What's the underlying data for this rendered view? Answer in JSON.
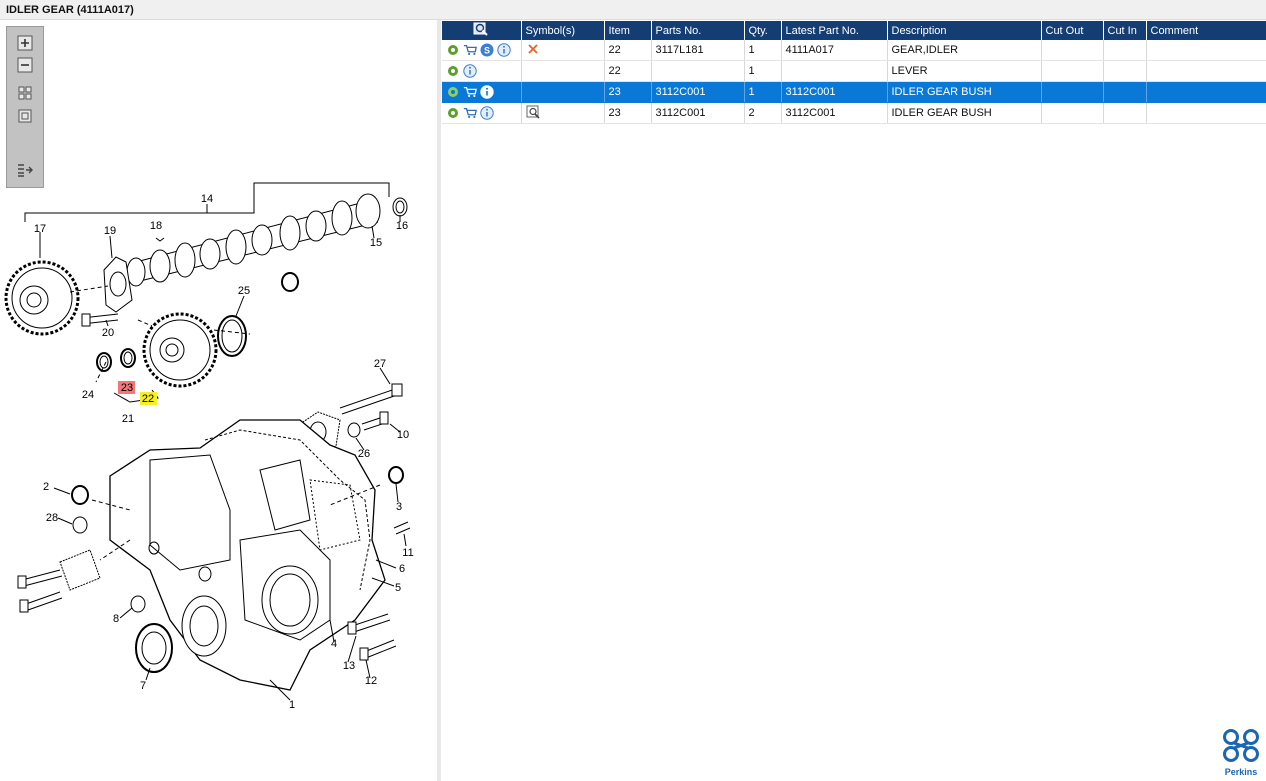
{
  "window": {
    "title": "IDLER GEAR (4111A017)"
  },
  "toolbar": {
    "zoom_in": "zoom-in-icon",
    "zoom_out": "zoom-out-icon",
    "fit": "fit-icon",
    "actual": "actual-size-icon",
    "export": "export-list-icon"
  },
  "drawing": {
    "labels": {
      "l1": "1",
      "l2": "2",
      "l3": "3",
      "l4": "4",
      "l5": "5",
      "l6": "6",
      "l7": "7",
      "l8": "8",
      "l10": "10",
      "l11": "11",
      "l12": "12",
      "l13": "13",
      "l14": "14",
      "l15": "15",
      "l16": "16",
      "l17": "17",
      "l18": "18",
      "l19": "19",
      "l20": "20",
      "l21": "21",
      "l24": "24",
      "l25": "25",
      "l26": "26",
      "l27": "27",
      "l28": "28"
    },
    "highlight_23": "23",
    "highlight_22": "22",
    "colors": {
      "highlight_red": "#f27878",
      "highlight_yellow": "#f5ee2a"
    }
  },
  "table": {
    "columns": [
      "",
      "Symbol(s)",
      "Item",
      "Parts No.",
      "Qty.",
      "Latest Part No.",
      "Description",
      "Cut Out",
      "Cut In",
      "Comment"
    ],
    "rows": [
      {
        "item": "22",
        "parts_no": "3117L181",
        "qty": "1",
        "latest": "4111A017",
        "description": "GEAR,IDLER",
        "cut_out": "",
        "cut_in": "",
        "comment": ""
      },
      {
        "item": "22",
        "parts_no": "",
        "qty": "1",
        "latest": "",
        "description": "LEVER",
        "cut_out": "",
        "cut_in": "",
        "comment": ""
      },
      {
        "item": "23",
        "parts_no": "3112C001",
        "qty": "1",
        "latest": "3112C001",
        "description": "IDLER GEAR BUSH",
        "cut_out": "",
        "cut_in": "",
        "comment": ""
      },
      {
        "item": "23",
        "parts_no": "3112C001",
        "qty": "2",
        "latest": "3112C001",
        "description": "IDLER GEAR BUSH",
        "cut_out": "",
        "cut_in": "",
        "comment": ""
      }
    ],
    "colors": {
      "header_bg": "#143d73",
      "selected_bg": "#0a78d7"
    }
  },
  "brand": {
    "name": "Perkins",
    "color": "#1a66b3"
  }
}
